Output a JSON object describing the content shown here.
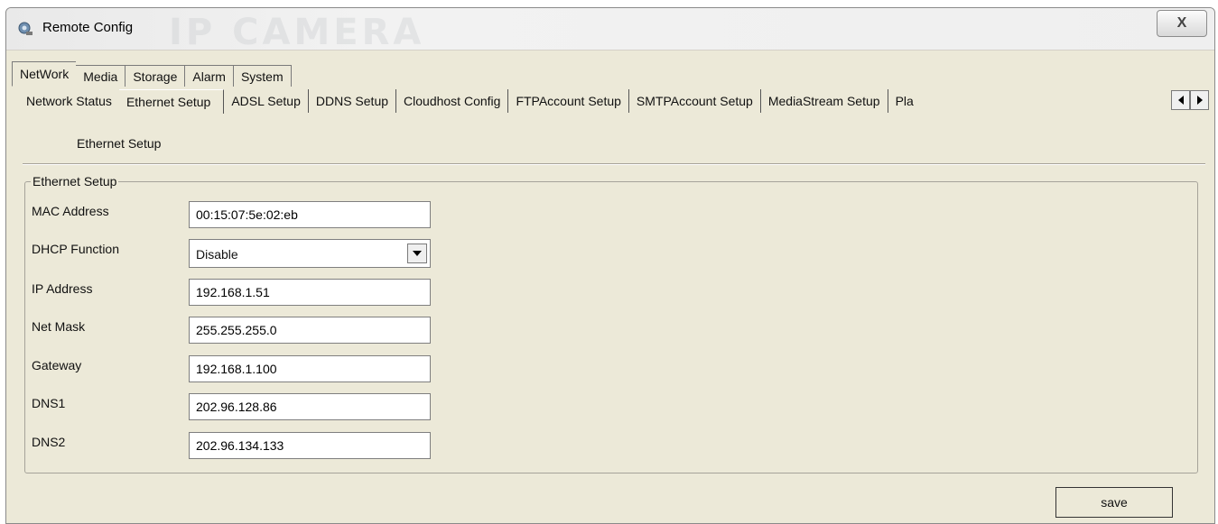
{
  "window": {
    "title": "Remote Config",
    "close_label": "X",
    "watermark": "IP CAMERA"
  },
  "tabs_top": [
    "NetWork",
    "Media",
    "Storage",
    "Alarm",
    "System"
  ],
  "tabs_sub": [
    "Network Status",
    "Ethernet Setup",
    "ADSL Setup",
    "DDNS Setup",
    "Cloudhost Config",
    "FTPAccount Setup",
    "SMTPAccount Setup",
    "MediaStream Setup",
    "Pla"
  ],
  "panel": {
    "title": "Ethernet Setup",
    "group_title": "Ethernet Setup"
  },
  "fields": {
    "mac": {
      "label": "MAC Address",
      "value": "00:15:07:5e:02:eb"
    },
    "dhcp": {
      "label": "DHCP Function",
      "value": "Disable"
    },
    "ip": {
      "label": "IP Address",
      "value": "192.168.1.51"
    },
    "mask": {
      "label": "Net Mask",
      "value": "255.255.255.0"
    },
    "gateway": {
      "label": "Gateway",
      "value": "192.168.1.100"
    },
    "dns1": {
      "label": "DNS1",
      "value": "202.96.128.86"
    },
    "dns2": {
      "label": "DNS2",
      "value": "202.96.134.133"
    }
  },
  "buttons": {
    "save": "save"
  }
}
